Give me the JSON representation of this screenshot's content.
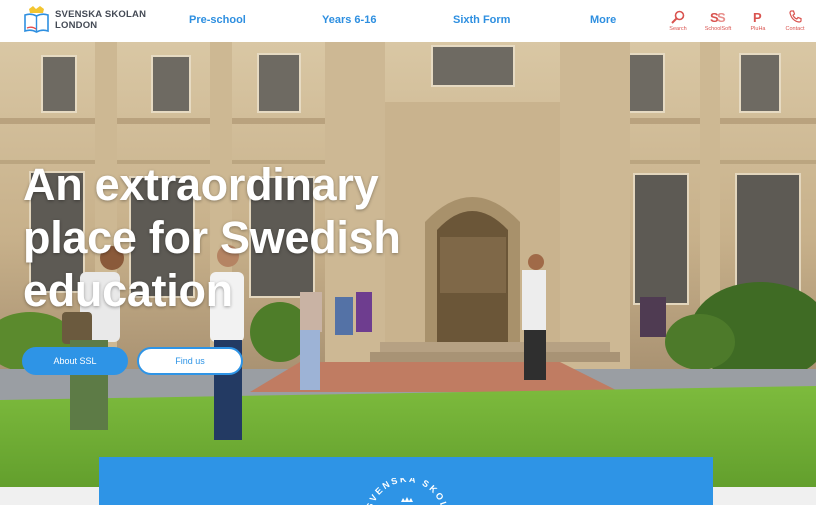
{
  "header": {
    "logo_line1": "SVENSKA SKOLAN",
    "logo_line2": "LONDON",
    "nav": [
      {
        "label": "Pre-school"
      },
      {
        "label": "Years 6-16"
      },
      {
        "label": "Sixth Form"
      },
      {
        "label": "More"
      }
    ],
    "utilities": [
      {
        "label": "Search",
        "icon": "search-icon"
      },
      {
        "label": "SchoolSoft",
        "icon": "schoolsoft-icon"
      },
      {
        "label": "PluHa",
        "icon": "pluha-icon"
      },
      {
        "label": "Contact",
        "icon": "phone-icon"
      }
    ],
    "accent_color": "#2e8fe0",
    "utility_color": "#d9534f"
  },
  "hero": {
    "headline_line1": "An extraordinary",
    "headline_line2": "place for Swedish",
    "headline_line3": "education",
    "about_button": "About SSL",
    "find_button": "Find us"
  },
  "seal": {
    "text": "SVENSKA SKOL"
  }
}
